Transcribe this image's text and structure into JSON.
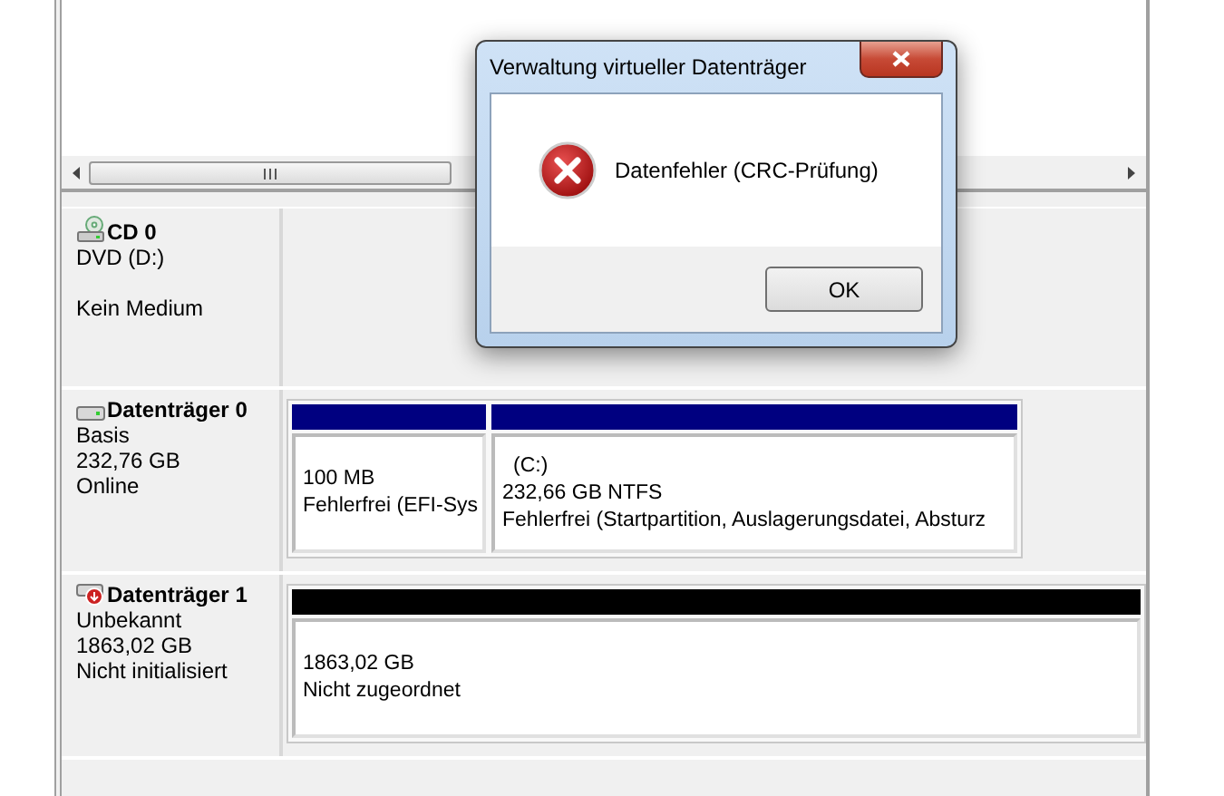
{
  "disks": [
    {
      "kind": "cd",
      "name": "CD 0",
      "lines": [
        "DVD (D:)"
      ],
      "note": "Kein Medium"
    },
    {
      "kind": "basic",
      "name": "Datenträger 0",
      "lines": [
        "Basis",
        "232,76 GB",
        "Online"
      ],
      "partitions": [
        {
          "color": "#000080",
          "size": "100 MB",
          "status": "Fehlerfrei (EFI-Sys"
        },
        {
          "color": "#000080",
          "label": "(C:)",
          "size": "232,66 GB NTFS",
          "status": "Fehlerfrei (Startpartition, Auslagerungsdatei, Absturz"
        }
      ]
    },
    {
      "kind": "unknown",
      "name": "Datenträger 1",
      "lines": [
        "Unbekannt",
        "1863,02 GB",
        "Nicht initialisiert"
      ],
      "partitions": [
        {
          "color": "#000000",
          "size": "1863,02 GB",
          "status": "Nicht zugeordnet"
        }
      ]
    }
  ],
  "dialog": {
    "title": "Verwaltung virtueller Datenträger",
    "message": "Datenfehler (CRC-Prüfung)",
    "buttons": [
      "OK"
    ]
  }
}
